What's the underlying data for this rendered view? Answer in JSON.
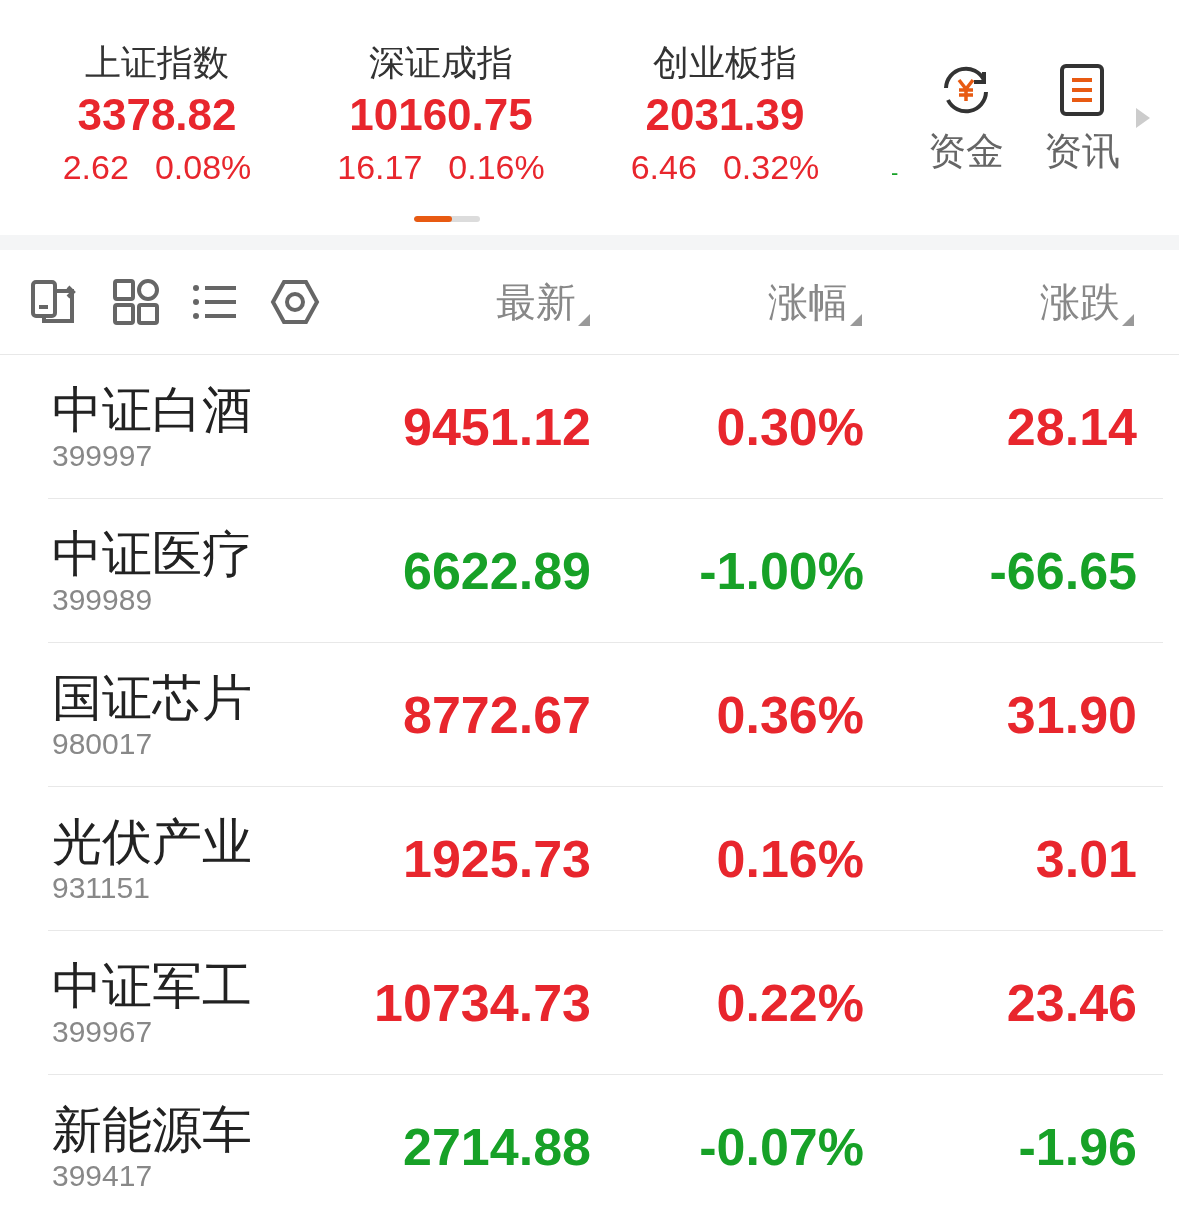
{
  "indices": [
    {
      "name": "上证指数",
      "value": "3378.82",
      "change": "2.62",
      "percent": "0.08%",
      "color": "#e8262d"
    },
    {
      "name": "深证成指",
      "value": "10160.75",
      "change": "16.17",
      "percent": "0.16%",
      "color": "#e8262d"
    },
    {
      "name": "创业板指",
      "value": "2031.39",
      "change": "6.46",
      "percent": "0.32%",
      "color": "#e8262d"
    }
  ],
  "overflow_mark": "-",
  "shortcuts": [
    {
      "label": "资金",
      "kind": "funds"
    },
    {
      "label": "资讯",
      "kind": "news"
    }
  ],
  "page_indicator": {
    "level": 0.58
  },
  "columns": [
    "最新",
    "涨幅",
    "涨跌"
  ],
  "rows": [
    {
      "name": "中证白酒",
      "code": "399997",
      "latest": "9451.12",
      "percent": "0.30%",
      "change": "28.14",
      "color": "#e8262d"
    },
    {
      "name": "中证医疗",
      "code": "399989",
      "latest": "6622.89",
      "percent": "-1.00%",
      "change": "-66.65",
      "color": "#17a127"
    },
    {
      "name": "国证芯片",
      "code": "980017",
      "latest": "8772.67",
      "percent": "0.36%",
      "change": "31.90",
      "color": "#e8262d"
    },
    {
      "name": "光伏产业",
      "code": "931151",
      "latest": "1925.73",
      "percent": "0.16%",
      "change": "3.01",
      "color": "#e8262d"
    },
    {
      "name": "中证军工",
      "code": "399967",
      "latest": "10734.73",
      "percent": "0.22%",
      "change": "23.46",
      "color": "#e8262d"
    },
    {
      "name": "新能源车",
      "code": "399417",
      "latest": "2714.88",
      "percent": "-0.07%",
      "change": "-1.96",
      "color": "#17a127"
    }
  ]
}
